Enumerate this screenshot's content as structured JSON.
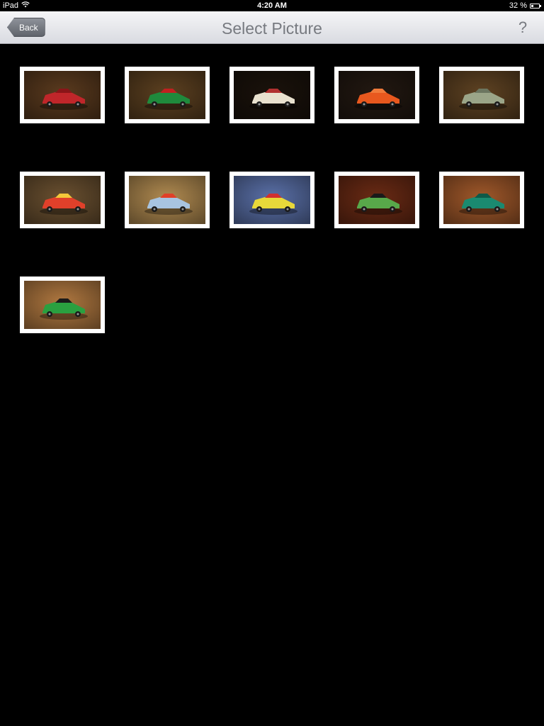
{
  "status_bar": {
    "device": "iPad",
    "time": "4:20 AM",
    "battery_percent": "32 %",
    "battery_level": 0.32
  },
  "nav": {
    "title": "Select Picture",
    "back_label": "Back",
    "help_label": "?"
  },
  "pictures": [
    {
      "name": "red-sports-car",
      "bg": "#5a3a1e",
      "body": "#c0262a",
      "accent": "#8a1518"
    },
    {
      "name": "green-steam-roller",
      "bg": "#5c4020",
      "body": "#1f8a3c",
      "accent": "#c02020"
    },
    {
      "name": "white-vintage-roadster",
      "bg": "#1a120b",
      "body": "#e8e1cf",
      "accent": "#b03030"
    },
    {
      "name": "orange-cement-trucks",
      "bg": "#221811",
      "body": "#e8581e",
      "accent": "#f07a3a"
    },
    {
      "name": "green-bus",
      "bg": "#5e4222",
      "body": "#9ba588",
      "accent": "#6c7660"
    },
    {
      "name": "red-car-with-box",
      "bg": "#6a5030",
      "body": "#e0402a",
      "accent": "#f4c83a"
    },
    {
      "name": "blue-van",
      "bg": "#b08a50",
      "body": "#a8c4e0",
      "accent": "#e04028"
    },
    {
      "name": "yellow-racer",
      "bg": "#5a70a8",
      "body": "#e8d83a",
      "accent": "#d03030"
    },
    {
      "name": "green-sedan",
      "bg": "#6a2a14",
      "body": "#58a84a",
      "accent": "#1a1a1a"
    },
    {
      "name": "teal-coupe",
      "bg": "#a0582a",
      "body": "#1a8a70",
      "accent": "#0e5a48"
    },
    {
      "name": "green-hatchback",
      "bg": "#b07840",
      "body": "#2aa040",
      "accent": "#1a1a1a"
    }
  ]
}
